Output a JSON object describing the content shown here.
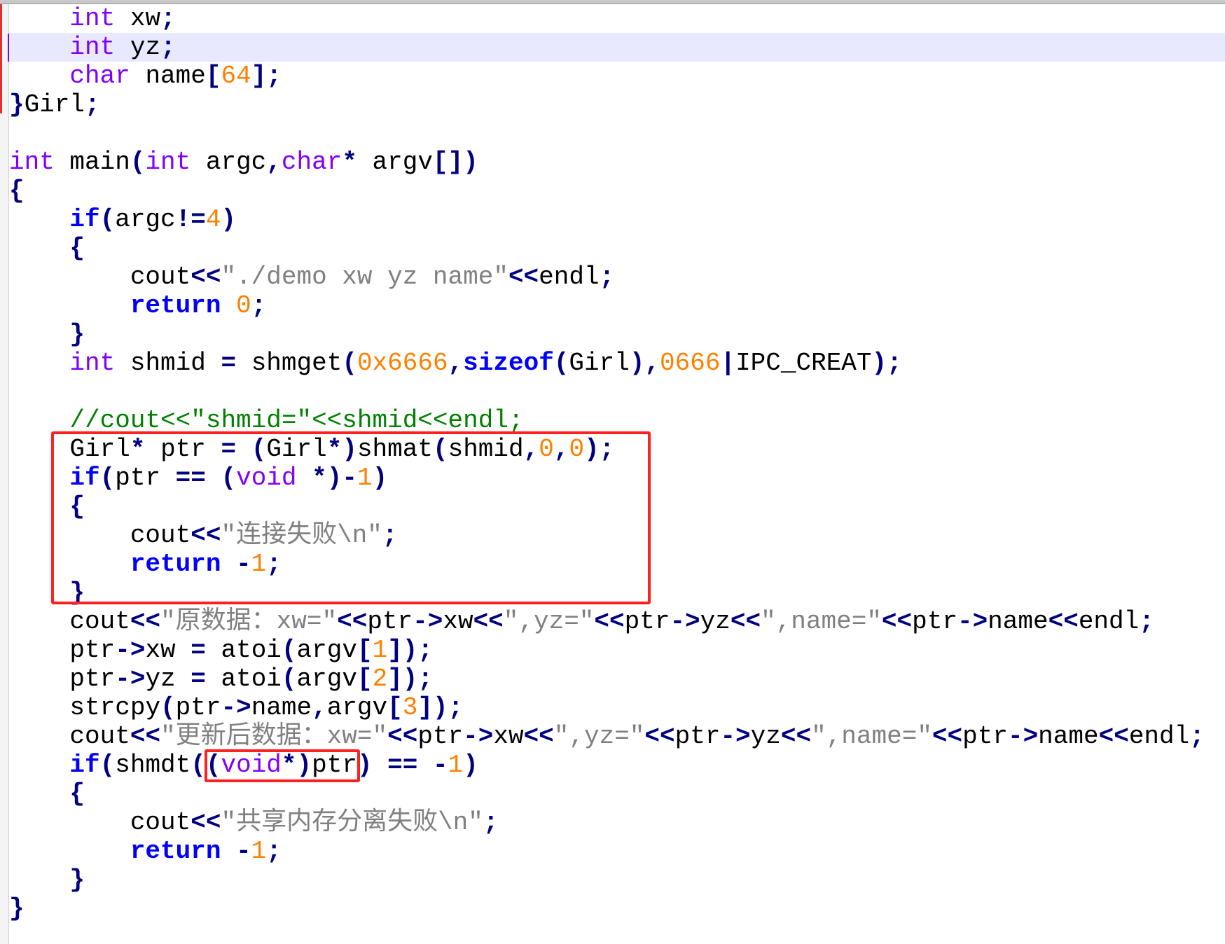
{
  "editor": {
    "highlighted_line": 1,
    "lines": [
      "    int xw;",
      "    int yz;",
      "    char name[64];",
      "}Girl;",
      "",
      "int main(int argc,char* argv[])",
      "{",
      "    if(argc!=4)",
      "    {",
      "        cout<<\"./demo xw yz name\"<<endl;",
      "        return 0;",
      "    }",
      "    int shmid = shmget(0x6666,sizeof(Girl),0666|IPC_CREAT);",
      "",
      "    //cout<<\"shmid=\"<<shmid<<endl;",
      "    Girl* ptr = (Girl*)shmat(shmid,0,0);",
      "    if(ptr == (void *)-1)",
      "    {",
      "        cout<<\"连接失败\\n\";",
      "        return -1;",
      "    }",
      "    cout<<\"原数据：xw=\"<<ptr->xw<<\",yz=\"<<ptr->yz<<\",name=\"<<ptr->name<<endl;",
      "    ptr->xw = atoi(argv[1]);",
      "    ptr->yz = atoi(argv[2]);",
      "    strcpy(ptr->name,argv[3]);",
      "    cout<<\"更新后数据：xw=\"<<ptr->xw<<\",yz=\"<<ptr->yz<<\",name=\"<<ptr->name<<endl;",
      "    if(shmdt((void*)ptr) == -1)",
      "    {",
      "        cout<<\"共享内存分离失败\\n\";",
      "        return -1;",
      "    }",
      "}"
    ]
  },
  "colors": {
    "type_keyword": "#8000ff",
    "control_keyword": "#0000ff",
    "operator": "#000080",
    "number": "#ff8000",
    "string": "#808080",
    "comment": "#008000",
    "line_highlight": "#e8e8ff",
    "annotation_box": "#ff2020"
  }
}
